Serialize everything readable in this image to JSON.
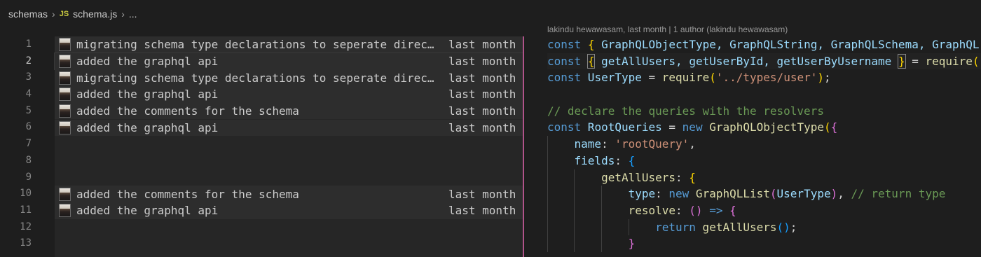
{
  "breadcrumb": {
    "folder": "schemas",
    "file_icon": "JS",
    "file": "schema.js",
    "more": "..."
  },
  "line_numbers": [
    "1",
    "2",
    "3",
    "4",
    "5",
    "6",
    "7",
    "8",
    "9",
    "10",
    "11",
    "12",
    "13"
  ],
  "active_line": "2",
  "blame": [
    {
      "message": "migrating schema type declarations to seperate directory",
      "date": "last month"
    },
    {
      "message": "added the graphql api",
      "date": "last month"
    },
    {
      "message": "migrating schema type declarations to seperate directory",
      "date": "last month"
    },
    {
      "message": "added the graphql api",
      "date": "last month"
    },
    {
      "message": "added the comments for the schema",
      "date": "last month"
    },
    {
      "message": "added the graphql api",
      "date": "last month"
    },
    {
      "message": "added the comments for the schema",
      "date": "last month"
    },
    {
      "message": "added the graphql api",
      "date": "last month"
    }
  ],
  "codelens": "lakindu hewawasam, last month | 1 author (lakindu hewawasam)",
  "code": {
    "l1": {
      "kw": "const",
      "open": "{",
      "names": " GraphQLObjectType, GraphQLString, GraphQLSchema, GraphQL"
    },
    "l2": {
      "kw": "const",
      "open": "{",
      "names": " getAllUsers, getUserById, getUserByUsername ",
      "close": "}",
      "eq": " = ",
      "fn": "require",
      "paren": "("
    },
    "l3": {
      "kw": "const",
      "name": " UserType",
      "eq": " = ",
      "fn": "require",
      "p1": "(",
      "str": "'../types/user'",
      "p2": ")",
      "semi": ";"
    },
    "l5": {
      "comment": "// declare the queries with the resolvers"
    },
    "l6": {
      "kw": "const",
      "name": " RootQueries",
      "eq": " = ",
      "new": "new",
      "cls": " GraphQLObjectType",
      "p1": "(",
      "b1": "{"
    },
    "l7": {
      "key": "name",
      "colon": ": ",
      "str": "'rootQuery'",
      "comma": ","
    },
    "l8": {
      "key": "fields",
      "colon": ": ",
      "b": "{"
    },
    "l9": {
      "key": "getAllUsers",
      "colon": ": ",
      "b": "{"
    },
    "l10": {
      "key": "type",
      "colon": ": ",
      "new": "new",
      "cls": " GraphQLList",
      "p1": "(",
      "arg": "UserType",
      "p2": ")",
      "comma": ", ",
      "comment": "// return type"
    },
    "l11": {
      "key": "resolve",
      "colon": ": ",
      "p": "()",
      "arrow": " => ",
      "b": "{"
    },
    "l12": {
      "kw": "return",
      "fn": " getAllUsers",
      "p": "()",
      "semi": ";"
    },
    "l13": {
      "b": "}"
    }
  },
  "colors": {
    "background": "#1e1e1e",
    "blame_bg": "#2d2d2d",
    "divider": "#b0538a",
    "keyword": "#569cd6",
    "class": "#4ec9b0",
    "string": "#ce9178",
    "comment": "#6a9955"
  }
}
